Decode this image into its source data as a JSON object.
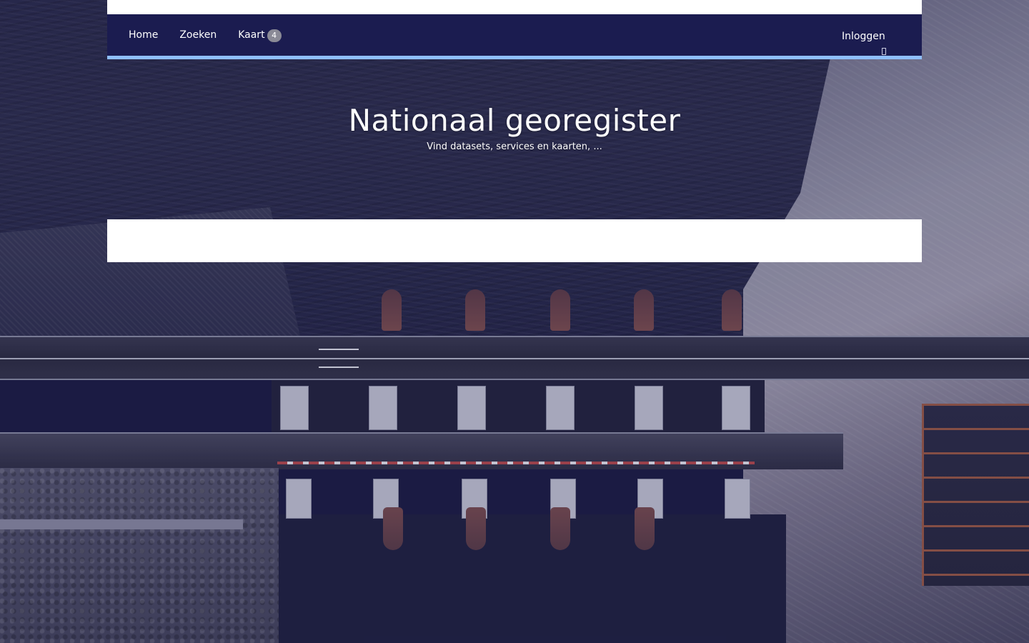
{
  "nav": {
    "items": [
      {
        "label": "Home"
      },
      {
        "label": "Zoeken"
      },
      {
        "label": "Kaart",
        "badge": "4"
      }
    ],
    "login_label": "Inloggen",
    "login_icon": "user-icon",
    "accent_color": "#8fbfff",
    "bar_color": "#1b1c50"
  },
  "hero": {
    "title": "Nationaal georegister",
    "subtitle": "Vind datasets, services en kaarten, ..."
  },
  "search": {
    "value": "",
    "placeholder": ""
  }
}
